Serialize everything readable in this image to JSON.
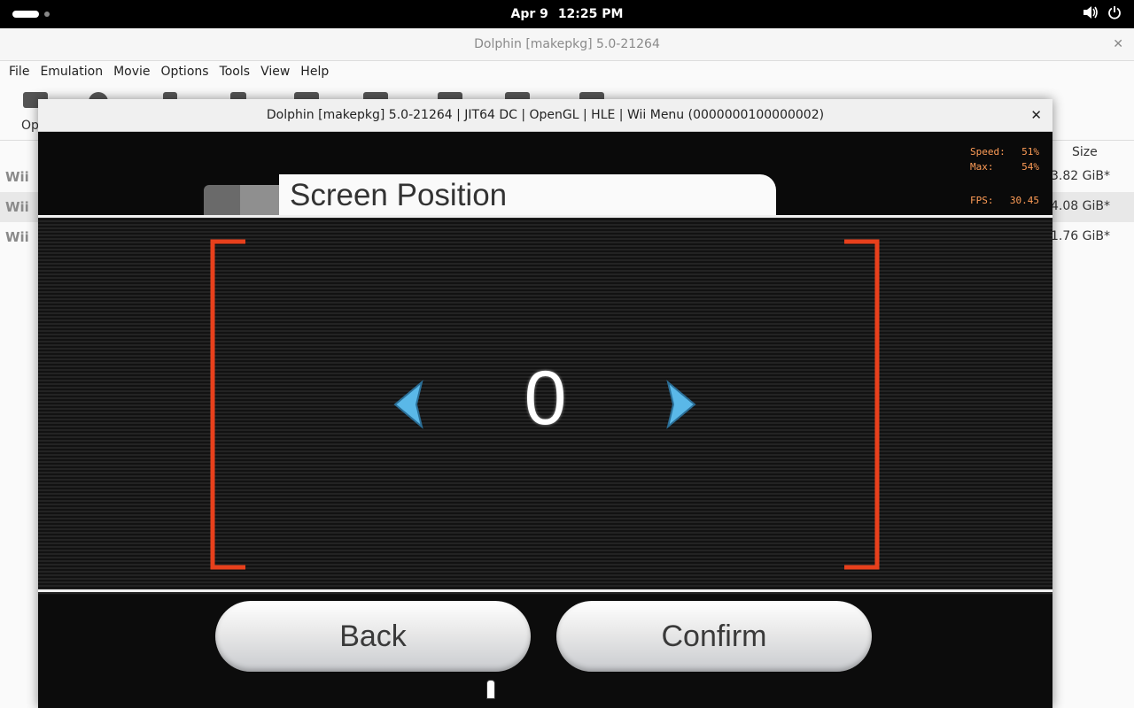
{
  "topbar": {
    "date": "Apr 9",
    "time": "12:25 PM",
    "icons": [
      "activities-indicator",
      "volume-icon",
      "power-icon"
    ]
  },
  "main_window": {
    "title": "Dolphin [makepkg] 5.0-21264",
    "menu": [
      "File",
      "Emulation",
      "Movie",
      "Options",
      "Tools",
      "View",
      "Help"
    ],
    "toolbar_first_label": "Op",
    "columns": {
      "size": "Size"
    },
    "rows": [
      {
        "platform": "Wii",
        "size": "3.82 GiB*"
      },
      {
        "platform": "Wii",
        "size": "4.08 GiB*"
      },
      {
        "platform": "Wii",
        "size": "1.76 GiB*"
      }
    ]
  },
  "render_window": {
    "title": "Dolphin [makepkg] 5.0-21264 | JIT64 DC | OpenGL | HLE | Wii Menu (0000000100000002)",
    "perf": {
      "speed_label": "Speed:",
      "speed_value": "51%",
      "max_label": "Max:",
      "max_value": "54%",
      "fps_label": "FPS:",
      "fps_value": "30.45"
    },
    "game": {
      "header_title": "Screen Position",
      "value": "0",
      "back_label": "Back",
      "confirm_label": "Confirm",
      "accent_color": "#e8401c",
      "arrow_color": "#5ab8e8"
    }
  }
}
